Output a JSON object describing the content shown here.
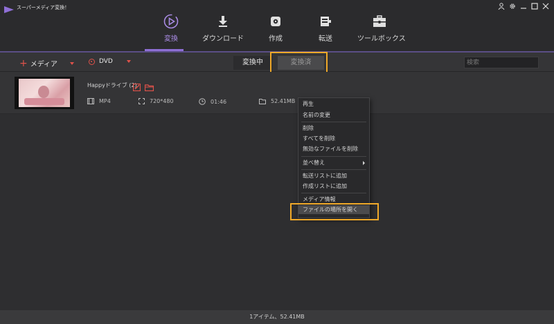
{
  "app": {
    "title": "スーパーメディア変換！"
  },
  "window_controls": [
    "user-icon",
    "gear-icon",
    "minimize-icon",
    "maximize-icon",
    "close-icon"
  ],
  "nav": {
    "items": [
      {
        "label": "変換",
        "icon": "convert-play-icon",
        "active": true
      },
      {
        "label": "ダウンロード",
        "icon": "download-icon",
        "active": false
      },
      {
        "label": "作成",
        "icon": "burn-disc-icon",
        "active": false
      },
      {
        "label": "転送",
        "icon": "transfer-icon",
        "active": false
      },
      {
        "label": "ツールボックス",
        "icon": "toolbox-icon",
        "active": false
      }
    ]
  },
  "toolbar": {
    "add_media_label": "メディア",
    "dvd_label": "DVD",
    "tab_converting": "変換中",
    "tab_converted": "変換済",
    "search_placeholder": "検索"
  },
  "media": {
    "name": "Happyドライブ (2)",
    "format": "MP4",
    "resolution": "720*480",
    "duration": "01:46",
    "size": "52.41MB"
  },
  "context_menu": {
    "play": "再生",
    "rename": "名前の変更",
    "delete": "削除",
    "delete_all": "すべてを削除",
    "delete_invalid": "無効なファイルを削除",
    "sort": "並べ替え",
    "add_transfer": "転送リストに追加",
    "add_create": "作成リストに追加",
    "media_info": "メディア情報",
    "open_location": "ファイルの場所を開く"
  },
  "status": {
    "text": "1アイテム、52.41MB"
  },
  "colors": {
    "accent": "#8f6fd6",
    "highlight": "#f0a929",
    "red": "#e0524a"
  }
}
